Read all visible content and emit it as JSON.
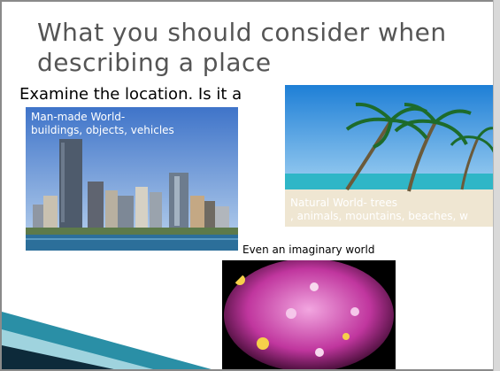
{
  "slide": {
    "title_line1": "What you should consider when",
    "title_line2": "describing a place",
    "subtitle": "Examine the location. Is it a",
    "city_caption_line1": "Man-made World-",
    "city_caption_line2": "buildings, objects, vehicles",
    "beach_caption_line1": "Natural World- trees",
    "beach_caption_line2": ", animals, mountains, beaches, w",
    "imaginary_label": "Even an imaginary world"
  },
  "colors": {
    "title": "#555555",
    "accent_teal": "#2a8fa6",
    "accent_dark": "#0d2a3a"
  }
}
